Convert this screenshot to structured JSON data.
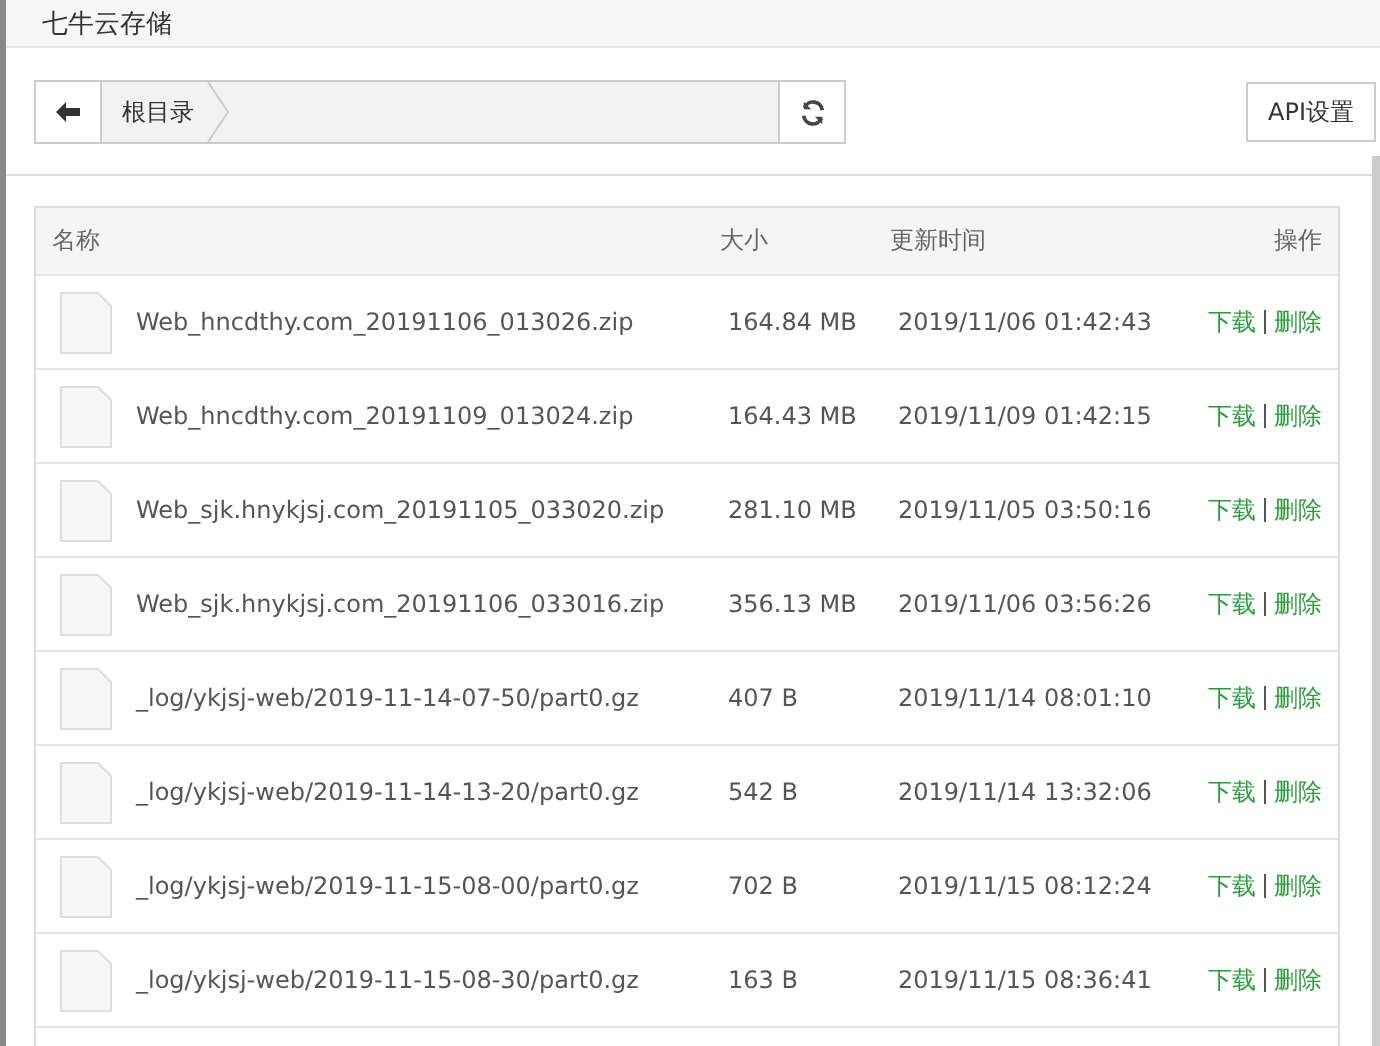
{
  "window": {
    "title": "七牛云存储"
  },
  "toolbar": {
    "breadcrumb": "根目录",
    "api_button": "API设置"
  },
  "table": {
    "columns": [
      "名称",
      "大小",
      "更新时间",
      "操作"
    ],
    "rows": [
      {
        "name": "Web_hncdthy.com_20191106_013026.zip",
        "size": "164.84 MB",
        "time": "2019/11/06 01:42:43",
        "download": "下载",
        "delete": "删除"
      },
      {
        "name": "Web_hncdthy.com_20191109_013024.zip",
        "size": "164.43 MB",
        "time": "2019/11/09 01:42:15",
        "download": "下载",
        "delete": "删除"
      },
      {
        "name": "Web_sjk.hnykjsj.com_20191105_033020.zip",
        "size": "281.10 MB",
        "time": "2019/11/05 03:50:16",
        "download": "下载",
        "delete": "删除"
      },
      {
        "name": "Web_sjk.hnykjsj.com_20191106_033016.zip",
        "size": "356.13 MB",
        "time": "2019/11/06 03:56:26",
        "download": "下载",
        "delete": "删除"
      },
      {
        "name": "_log/ykjsj-web/2019-11-14-07-50/part0.gz",
        "size": "407 B",
        "time": "2019/11/14 08:01:10",
        "download": "下载",
        "delete": "删除"
      },
      {
        "name": "_log/ykjsj-web/2019-11-14-13-20/part0.gz",
        "size": "542 B",
        "time": "2019/11/14 13:32:06",
        "download": "下载",
        "delete": "删除"
      },
      {
        "name": "_log/ykjsj-web/2019-11-15-08-00/part0.gz",
        "size": "702 B",
        "time": "2019/11/15 08:12:24",
        "download": "下载",
        "delete": "删除"
      },
      {
        "name": "_log/ykjsj-web/2019-11-15-08-30/part0.gz",
        "size": "163 B",
        "time": "2019/11/15 08:36:41",
        "download": "下载",
        "delete": "删除"
      }
    ]
  }
}
